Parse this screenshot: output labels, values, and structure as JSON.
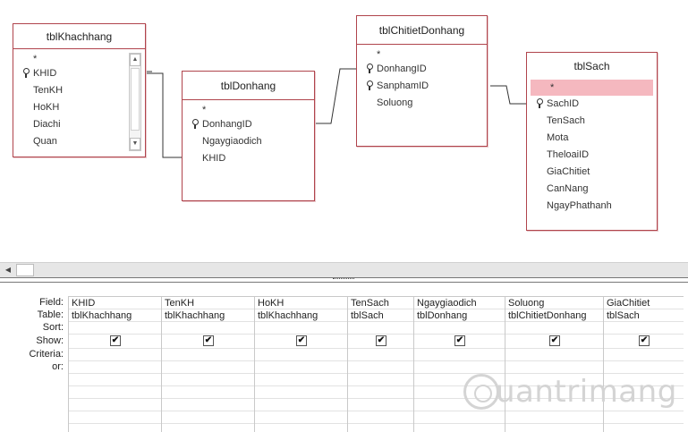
{
  "tables": [
    {
      "title": "tblKhachhang",
      "fields": [
        {
          "name": "*",
          "key": false
        },
        {
          "name": "KHID",
          "key": true
        },
        {
          "name": "TenKH",
          "key": false
        },
        {
          "name": "HoKH",
          "key": false
        },
        {
          "name": "Diachi",
          "key": false
        },
        {
          "name": "Quan",
          "key": false
        }
      ]
    },
    {
      "title": "tblDonhang",
      "fields": [
        {
          "name": "*",
          "key": false
        },
        {
          "name": "DonhangID",
          "key": true
        },
        {
          "name": "Ngaygiaodich",
          "key": false
        },
        {
          "name": "KHID",
          "key": false
        }
      ]
    },
    {
      "title": "tblChitietDonhang",
      "fields": [
        {
          "name": "*",
          "key": false
        },
        {
          "name": "DonhangID",
          "key": true
        },
        {
          "name": "SanphamID",
          "key": true
        },
        {
          "name": "Soluong",
          "key": false
        }
      ]
    },
    {
      "title": "tblSach",
      "fields": [
        {
          "name": "*",
          "key": false
        },
        {
          "name": "SachID",
          "key": true
        },
        {
          "name": "TenSach",
          "key": false
        },
        {
          "name": "Mota",
          "key": false
        },
        {
          "name": "TheloaiID",
          "key": false
        },
        {
          "name": "GiaChitiet",
          "key": false
        },
        {
          "name": "CanNang",
          "key": false
        },
        {
          "name": "NgayPhathanh",
          "key": false
        }
      ]
    }
  ],
  "grid": {
    "row_labels": [
      "Field:",
      "Table:",
      "Sort:",
      "Show:",
      "Criteria:",
      "or:"
    ],
    "columns": [
      {
        "field": "KHID",
        "table": "tblKhachhang",
        "show": true
      },
      {
        "field": "TenKH",
        "table": "tblKhachhang",
        "show": true
      },
      {
        "field": "HoKH",
        "table": "tblKhachhang",
        "show": true
      },
      {
        "field": "TenSach",
        "table": "tblSach",
        "show": true
      },
      {
        "field": "Ngaygiaodich",
        "table": "tblDonhang",
        "show": true
      },
      {
        "field": "Soluong",
        "table": "tblChitietDonhang",
        "show": true
      },
      {
        "field": "GiaChitiet",
        "table": "tblSach",
        "show": true
      }
    ],
    "check_glyph": "✔"
  },
  "watermark": {
    "text": "uantrimang"
  },
  "colors": {
    "table_border": "#b0444c",
    "selected_row": "#f5b8bf"
  }
}
